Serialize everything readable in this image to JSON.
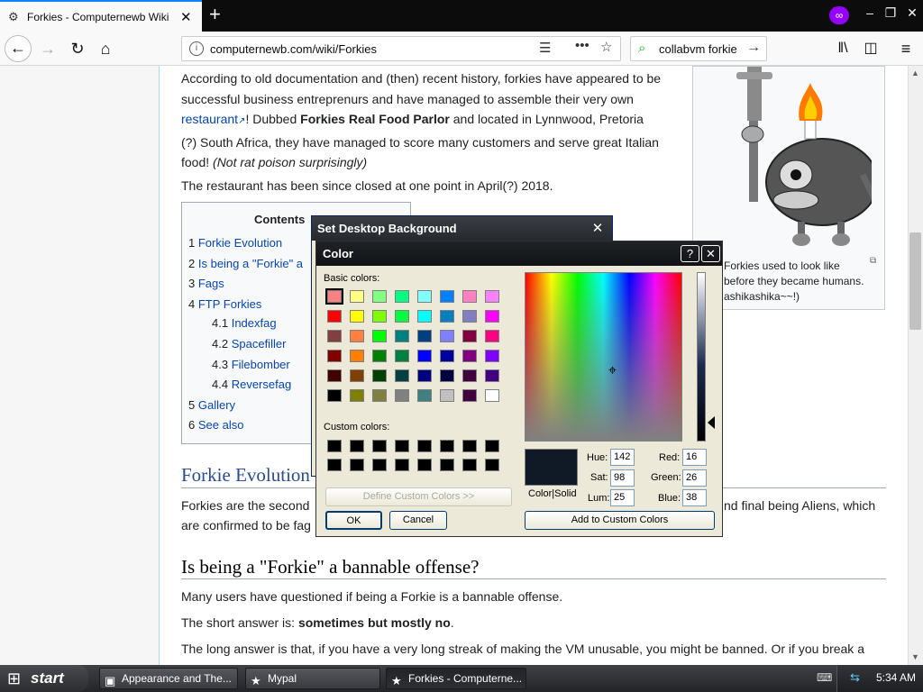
{
  "browser": {
    "tab_title": "Forkies - Computernewb Wiki",
    "url": "computernewb.com/wiki/Forkies",
    "search_query": "collabvm forkie"
  },
  "article": {
    "p1_a": "According to old documentation and (then) recent history, forkies have appeared to be",
    "p1_b": "successful business entreprenurs and have managed to assemble their very own",
    "p1_link": "restaurant",
    "p1_c": "! Dubbed ",
    "p1_bold": "Forkies Real Food Parlor",
    "p1_d": " and located in Lynnwood, Pretoria",
    "p1_e": "(?) South Africa, they have managed to score many customers and serve great Italian",
    "p1_f": "food! ",
    "p1_italic": "(Not rat poison surprisingly)",
    "p2": "The restaurant has been since closed at one point in April(?) 2018.",
    "caption_1": "Forkies used to look like",
    "caption_2": "before they became humans.",
    "caption_3": "ashikashika~~!)",
    "h_forkie_evolution": "Forkie Evolution",
    "p3_a": "Forkies are the second",
    "p3_b": "nd final being Aliens, which",
    "p3_c": "are confirmed to be fag",
    "h_bannable": "Is being a \"Forkie\" a bannable offense?",
    "p4": "Many users have questioned if being a Forkie is a bannable offense.",
    "p5_a": "The short answer is: ",
    "p5_bold": "sometimes but mostly no",
    "p5_b": ".",
    "p6": "The long answer is that, if you have a very long streak of making the VM unusable, you might be banned. Or if you break a"
  },
  "toc": {
    "title": "Contents",
    "items": [
      {
        "num": "1",
        "text": "Forkie Evolution"
      },
      {
        "num": "2",
        "text": "Is being a \"Forkie\" a"
      },
      {
        "num": "3",
        "text": "Fags"
      },
      {
        "num": "4",
        "text": "FTP Forkies"
      },
      {
        "num": "4.1",
        "text": "Indexfag"
      },
      {
        "num": "4.2",
        "text": "Spacefiller"
      },
      {
        "num": "4.3",
        "text": "Filebomber"
      },
      {
        "num": "4.4",
        "text": "Reversefag"
      },
      {
        "num": "5",
        "text": "Gallery"
      },
      {
        "num": "6",
        "text": "See also"
      }
    ]
  },
  "sdb_window": {
    "title": "Set Desktop Background"
  },
  "color_dialog": {
    "title": "Color",
    "basic_colors_label": "Basic colors:",
    "custom_colors_label": "Custom colors:",
    "define_custom": "Define Custom Colors >>",
    "ok": "OK",
    "cancel": "Cancel",
    "color_solid": "Color|Solid",
    "hue_label": "Hue:",
    "hue": "142",
    "sat_label": "Sat:",
    "sat": "98",
    "lum_label": "Lum:",
    "lum": "25",
    "red_label": "Red:",
    "red": "16",
    "green_label": "Green:",
    "green": "26",
    "blue_label": "Blue:",
    "blue": "38",
    "add_custom": "Add to Custom Colors",
    "basic_colors": [
      "#ff8080",
      "#ffff80",
      "#80ff80",
      "#00ff80",
      "#80ffff",
      "#0080ff",
      "#ff80c0",
      "#ff80ff",
      "#ff0000",
      "#ffff00",
      "#80ff00",
      "#00ff40",
      "#00ffff",
      "#0080c0",
      "#8080c0",
      "#ff00ff",
      "#804040",
      "#ff8040",
      "#00ff00",
      "#008080",
      "#004080",
      "#8080ff",
      "#800040",
      "#ff0080",
      "#800000",
      "#ff8000",
      "#008000",
      "#008040",
      "#0000ff",
      "#0000a0",
      "#800080",
      "#8000ff",
      "#400000",
      "#804000",
      "#004000",
      "#004040",
      "#000080",
      "#000040",
      "#400040",
      "#400080",
      "#000000",
      "#808000",
      "#808040",
      "#808080",
      "#408080",
      "#c0c0c0",
      "#400040",
      "#ffffff"
    ]
  },
  "taskbar": {
    "start": "start",
    "tasks": [
      "Appearance and The...",
      "Mypal",
      "Forkies - Computerne..."
    ],
    "clock": "5:34 AM"
  }
}
